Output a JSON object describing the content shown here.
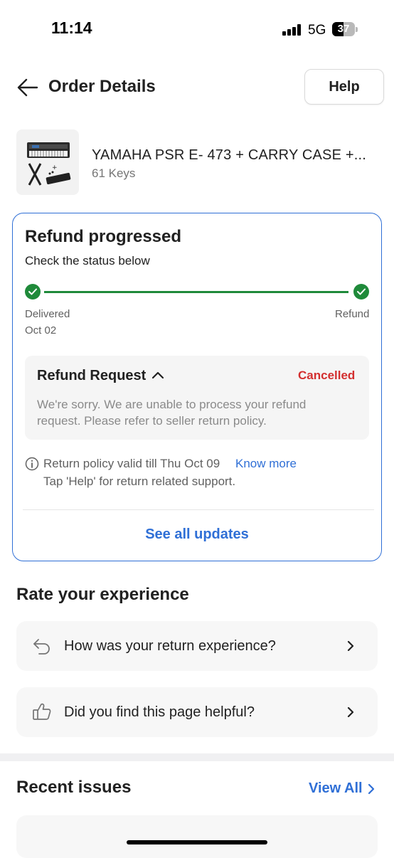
{
  "status_bar": {
    "time": "11:14",
    "network": "5G",
    "battery": "37"
  },
  "header": {
    "title": "Order Details",
    "help_label": "Help",
    "back_icon": "arrow-left-icon"
  },
  "product": {
    "name": "YAMAHA PSR E- 473 + CARRY CASE +...",
    "variant": "61 Keys"
  },
  "refund_card": {
    "title": "Refund progressed",
    "subtitle": "Check the status below",
    "steps": [
      {
        "label": "Delivered",
        "date": "Oct 02"
      },
      {
        "label": "Refund",
        "date": ""
      }
    ],
    "request": {
      "title": "Refund Request",
      "status": "Cancelled",
      "message": "We're sorry. We are unable to process your refund request. Please refer to seller return policy."
    },
    "policy": {
      "text": "Return policy valid till Thu Oct 09",
      "link": "Know more",
      "help_hint": "Tap 'Help' for return related support."
    },
    "see_all": "See all updates"
  },
  "rate": {
    "title": "Rate your experience",
    "items": [
      {
        "label": "How was your return experience?",
        "icon": "return-arrow-icon"
      },
      {
        "label": "Did you find this page helpful?",
        "icon": "thumbs-up-icon"
      }
    ]
  },
  "recent_issues": {
    "title": "Recent issues",
    "view_all": "View All"
  },
  "colors": {
    "accent": "#2f6fd6",
    "success": "#1f8a3a",
    "error": "#d32f2f"
  }
}
